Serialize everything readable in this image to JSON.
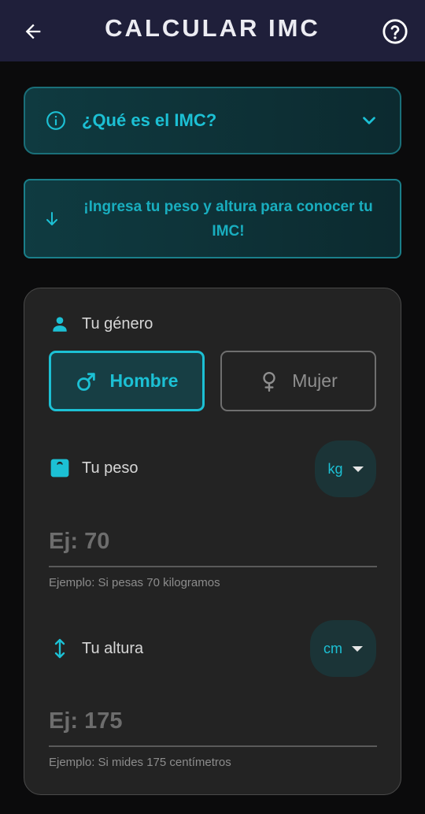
{
  "appbar": {
    "title": "CALCULAR IMC",
    "back_icon": "arrow-left-icon",
    "help_icon": "help-circle-icon"
  },
  "info_card": {
    "label": "¿Qué es el IMC?",
    "icon": "info-icon",
    "chevron": "chevron-down-icon"
  },
  "hint_card": {
    "text": "¡Ingresa tu peso y altura para conocer tu IMC!",
    "icon": "arrow-down-icon"
  },
  "gender": {
    "label": "Tu género",
    "options": [
      {
        "label": "Hombre",
        "icon": "male-icon",
        "selected": true
      },
      {
        "label": "Mujer",
        "icon": "female-icon",
        "selected": false
      }
    ]
  },
  "weight": {
    "label": "Tu peso",
    "unit": "kg",
    "placeholder": "Ej: 70",
    "helper": "Ejemplo: Si pesas 70 kilogramos"
  },
  "height": {
    "label": "Tu altura",
    "unit": "cm",
    "placeholder": "Ej: 175",
    "helper": "Ejemplo: Si mides 175 centímetros"
  },
  "colors": {
    "accent": "#1cc0d4",
    "appbar": "#1f1f3a",
    "background": "#0b0b0c",
    "card": "#232323"
  }
}
